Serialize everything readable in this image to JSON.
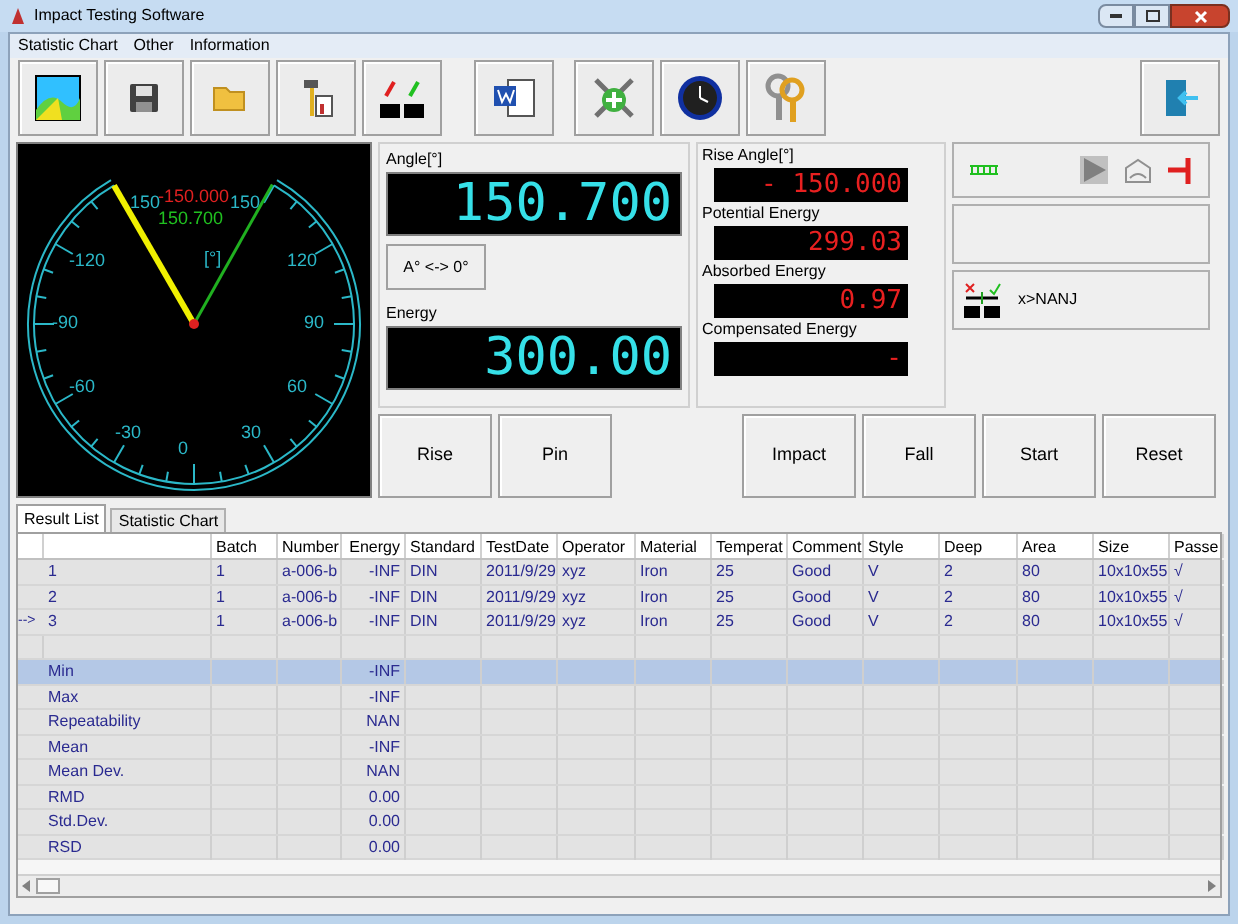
{
  "window": {
    "title": "Impact Testing Software"
  },
  "menu": [
    "Statistic Chart",
    "Other",
    "Information"
  ],
  "gauge": {
    "dial_labels": [
      "150",
      "-120",
      "-90",
      "-60",
      "-30",
      "0",
      "30",
      "60",
      "90",
      "120",
      "150"
    ],
    "rise_reading": "-150.000",
    "angle_reading": "150.700",
    "unit": "[°]"
  },
  "angle": {
    "label": "Angle[°]",
    "value": "150.700"
  },
  "zero_button": "A° <-> 0°",
  "energy": {
    "label": "Energy",
    "value": "300.00"
  },
  "readouts": [
    {
      "label": "Rise Angle[°]",
      "value": "- 150.000"
    },
    {
      "label": "Potential Energy",
      "value": "299.03"
    },
    {
      "label": "Absorbed Energy",
      "value": "0.97"
    },
    {
      "label": "Compensated Energy",
      "value": "-"
    }
  ],
  "limit_button": "x>NANJ",
  "buttons_left": [
    "Rise",
    "Pin"
  ],
  "buttons_right": [
    "Impact",
    "Fall",
    "Start",
    "Reset"
  ],
  "tabs": [
    {
      "label": "Result List",
      "selected": true
    },
    {
      "label": "Statistic Chart",
      "selected": false
    }
  ],
  "table": {
    "columns": [
      "",
      "Batch",
      "Number",
      "Energy",
      "Standard",
      "TestDate",
      "Operator",
      "Material",
      "Temperat",
      "Comment",
      "Style",
      "Deep",
      "Area",
      "Size",
      "Passe"
    ],
    "rows": [
      {
        "marker": "",
        "cells": [
          "1",
          "1",
          "a-006-b",
          "-INF",
          "DIN",
          "2011/9/29",
          "xyz",
          "Iron",
          "25",
          "Good",
          "V",
          "2",
          "80",
          "10x10x55",
          "√"
        ]
      },
      {
        "marker": "",
        "cells": [
          "2",
          "1",
          "a-006-b",
          "-INF",
          "DIN",
          "2011/9/29",
          "xyz",
          "Iron",
          "25",
          "Good",
          "V",
          "2",
          "80",
          "10x10x55",
          "√"
        ]
      },
      {
        "marker": "-->",
        "cells": [
          "3",
          "1",
          "a-006-b",
          "-INF",
          "DIN",
          "2011/9/29",
          "xyz",
          "Iron",
          "25",
          "Good",
          "V",
          "2",
          "80",
          "10x10x55",
          "√"
        ]
      }
    ],
    "stats": [
      {
        "label": "Min",
        "energy": "-INF",
        "selected": true
      },
      {
        "label": "Max",
        "energy": "-INF",
        "selected": false
      },
      {
        "label": "Repeatability",
        "energy": "NAN",
        "selected": false
      },
      {
        "label": "Mean",
        "energy": "-INF",
        "selected": false
      },
      {
        "label": "Mean Dev.",
        "energy": "NAN",
        "selected": false
      },
      {
        "label": "RMD",
        "energy": "0.00",
        "selected": false
      },
      {
        "label": "Std.Dev.",
        "energy": "0.00",
        "selected": false
      },
      {
        "label": "RSD",
        "energy": "0.00",
        "selected": false
      }
    ]
  }
}
